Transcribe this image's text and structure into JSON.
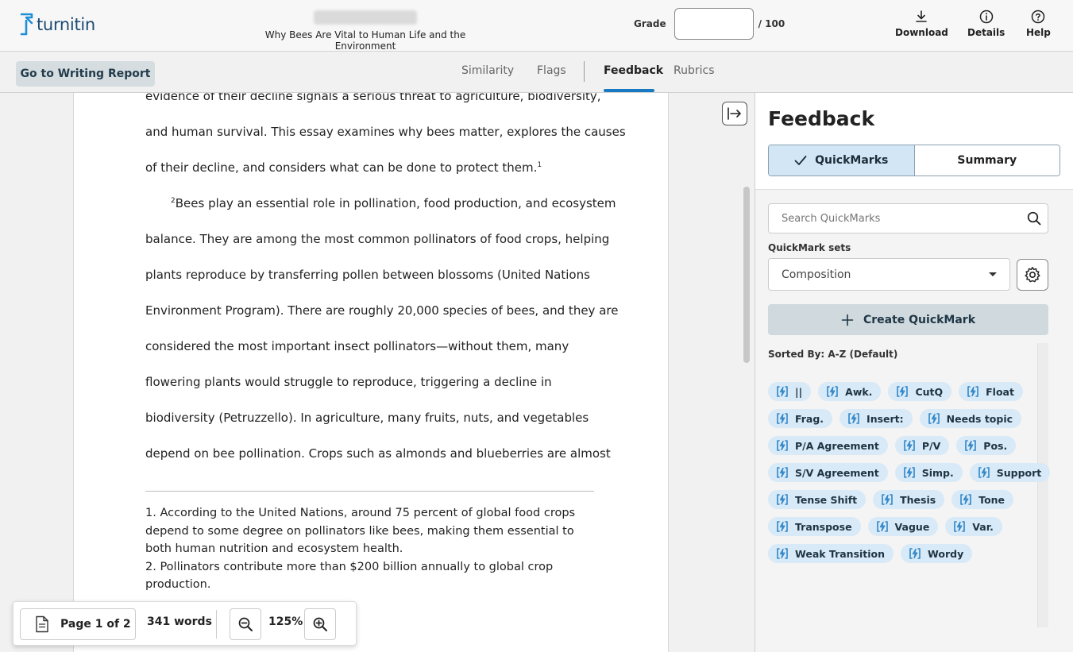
{
  "header": {
    "logo_text": "turnitin",
    "doc_title": "Why Bees Are Vital to Human Life and the Environment",
    "grade_label": "Grade",
    "grade_value": "",
    "grade_max": "/ 100",
    "download_label": "Download",
    "details_label": "Details",
    "help_label": "Help"
  },
  "subnav": {
    "writing_report_label": "Go to Writing Report",
    "tabs": [
      {
        "label": "Similarity"
      },
      {
        "label": "Flags"
      },
      {
        "label": "Feedback"
      },
      {
        "label": "Rubrics"
      }
    ],
    "active_tab": "Feedback"
  },
  "document": {
    "lines": [
      "evidence of their decline signals a serious threat to agriculture, biodiversity,",
      "and human survival. This essay examines why bees matter, explores the causes",
      "of their decline, and considers what can be done to protect them.",
      "Bees play an essential role in pollination, food production, and ecosystem",
      "balance. They are among the most common pollinators of food crops, helping",
      "plants reproduce by transferring pollen between blossoms (United Nations",
      "Environment Program). There are roughly 20,000 species of bees, and they are",
      "considered the most important insect pollinators—without them, many",
      "flowering plants would struggle to reproduce, triggering a decline in",
      "biodiversity (Petruzzello). In agriculture, many fruits, nuts, and vegetables",
      "depend on bee pollination. Crops such as almonds and blueberries are almost"
    ],
    "footnote_marker_1": "1",
    "footnote_marker_2": "2",
    "footnotes": [
      "1. According to the United Nations, around 75 percent of global food crops depend to some degree on pollinators like bees, making them essential to both human nutrition and ecosystem health.",
      "2. Pollinators contribute more than $200 billion annually to global crop production."
    ]
  },
  "toolbar": {
    "page_indicator": "Page 1 of 2",
    "word_count": "341 words",
    "zoom_level": "125%"
  },
  "feedback": {
    "title": "Feedback",
    "seg_quickmarks": "QuickMarks",
    "seg_summary": "Summary",
    "search_placeholder": "Search QuickMarks",
    "sets_label": "QuickMark sets",
    "sets_selected": "Composition",
    "create_label": "Create QuickMark",
    "sorted_label": "Sorted By: A-Z (Default)",
    "chip_rows": [
      [
        "||",
        "Awk.",
        "CutQ",
        "Float"
      ],
      [
        "Frag.",
        "Insert:",
        "Needs topic"
      ],
      [
        "P/A Agreement",
        "P/V",
        "Pos."
      ],
      [
        "S/V Agreement",
        "Simp.",
        "Support"
      ],
      [
        "Tense Shift",
        "Thesis",
        "Tone"
      ],
      [
        "Transpose",
        "Vague",
        "Var."
      ],
      [
        "Weak Transition",
        "Wordy"
      ]
    ]
  },
  "colors": {
    "brand": "#1b4b73",
    "accent": "#1979c3",
    "chip_bg": "#d8e9f7",
    "chip_icon": "#2f86c8"
  }
}
